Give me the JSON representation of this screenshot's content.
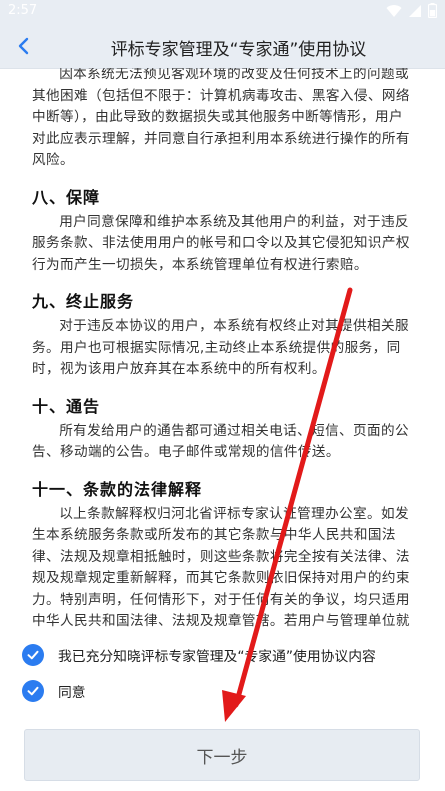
{
  "status_bar": {
    "time": "2:57"
  },
  "app_bar": {
    "title": "评标专家管理及“专家通”使用协议",
    "back_icon": "chevron-left-icon"
  },
  "agreement": {
    "intro_paragraph": "因本系统无法预见客观环境的改变及任何技术上的问题或其他困难（包括但不限于：计算机病毒攻击、黑客入侵、网络中断等），由此导致的数据损失或其他服务中断等情形，用户对此应表示理解，并同意自行承担利用本系统进行操作的所有风险。",
    "sections": [
      {
        "heading": "八、保障",
        "body": "用户同意保障和维护本系统及其他用户的利益，对于违反服务条款、非法使用用户的帐号和口令以及其它侵犯知识产权行为而产生一切损失，本系统管理单位有权进行索赔。"
      },
      {
        "heading": "九、终止服务",
        "body": "对于违反本协议的用户，本系统有权终止对其提供相关服务。用户也可根据实际情况,主动终止本系统提供的服务，同时，视为该用户放弃其在本系统中的所有权利。"
      },
      {
        "heading": "十、通告",
        "body": "所有发给用户的通告都可通过相关电话、短信、页面的公告、移动端的公告。电子邮件或常规的信件传送。"
      },
      {
        "heading": "十一、条款的法律解释",
        "body": "以上条款解释权归河北省评标专家认证管理办公室。如发生本系统服务条款或所发布的其它条款与中华人民共和国法律、法规及规章相抵触时，则这些条款将完全按有关法律、法规及规章规定重新解释，而其它条款则依旧保持对用户的约束力。特别声明，任何情形下，对于任何有关的争议，均只适用中华人民共和国法律、法规及规章管辖。若用户与管理单位就服务条款发生任何争议，双方应友好协商解决；协商不成时，任何一方可向管理单位所在地的有关人民法院提起诉讼解决。"
      }
    ]
  },
  "checkboxes": [
    {
      "label": "我已充分知晓评标专家管理及“专家通”使用协议内容",
      "checked": true
    },
    {
      "label": "同意",
      "checked": true
    }
  ],
  "next_button": {
    "label": "下一步"
  },
  "colors": {
    "accent": "#2b7cf0",
    "header_bg": "#e8edf3",
    "annotation_arrow": "#e21a1a"
  }
}
